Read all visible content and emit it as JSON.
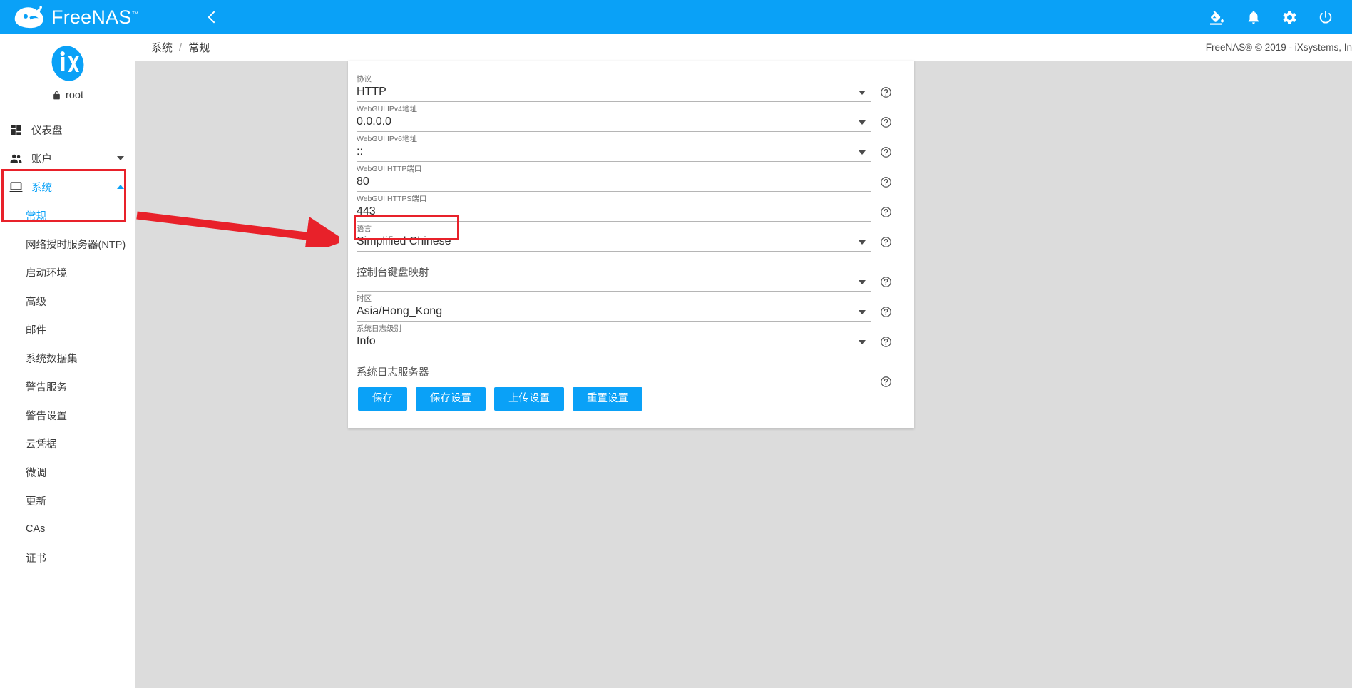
{
  "theme": {
    "accent": "#0aa1f7",
    "annotation": "#e8212a",
    "content_bg": "#dcdcdc"
  },
  "topbar": {
    "brand_name": "FreeNAS",
    "brand_tm": "™",
    "icons": [
      {
        "name": "menu-icon",
        "label": "☰"
      },
      {
        "name": "collapse-icon",
        "label": "‹"
      },
      {
        "name": "theme-picker-icon",
        "label": "theme"
      },
      {
        "name": "notifications-icon",
        "label": "bell"
      },
      {
        "name": "settings-icon",
        "label": "gear"
      },
      {
        "name": "power-icon",
        "label": "power"
      }
    ]
  },
  "breadcrumb": {
    "items": [
      "系统",
      "常规"
    ],
    "separator": "/",
    "copyright": "FreeNAS® © 2019 - iXsystems, In"
  },
  "sidebar": {
    "user": "root",
    "user_icon": "lock-icon",
    "items": [
      {
        "label": "仪表盘",
        "icon": "dashboard-icon",
        "expandable": false,
        "active": false
      },
      {
        "label": "账户",
        "icon": "people-icon",
        "expandable": true,
        "expanded": false,
        "active": false
      },
      {
        "label": "系统",
        "icon": "desktop-icon",
        "expandable": true,
        "expanded": true,
        "active": true
      }
    ],
    "system_children": [
      {
        "label": "常规",
        "active": true
      },
      {
        "label": "网络授时服务器(NTP)",
        "active": false
      },
      {
        "label": "启动环境",
        "active": false
      },
      {
        "label": "高级",
        "active": false
      },
      {
        "label": "邮件",
        "active": false
      },
      {
        "label": "系统数据集",
        "active": false
      },
      {
        "label": "警告服务",
        "active": false
      },
      {
        "label": "警告设置",
        "active": false
      },
      {
        "label": "云凭据",
        "active": false
      },
      {
        "label": "微调",
        "active": false
      },
      {
        "label": "更新",
        "active": false
      },
      {
        "label": "CAs",
        "active": false
      },
      {
        "label": "证书",
        "active": false
      }
    ]
  },
  "form": {
    "fields": [
      {
        "label": "协议",
        "value": "HTTP",
        "type": "select",
        "has_value": true
      },
      {
        "label": "WebGUI IPv4地址",
        "value": "0.0.0.0",
        "type": "select",
        "has_value": true
      },
      {
        "label": "WebGUI IPv6地址",
        "value": "::",
        "type": "select",
        "has_value": true
      },
      {
        "label": "WebGUI HTTP端口",
        "value": "80",
        "type": "text",
        "has_value": true
      },
      {
        "label": "WebGUI HTTPS端口",
        "value": "443",
        "type": "text",
        "has_value": true
      },
      {
        "label": "语言",
        "value": "Simplified Chinese",
        "type": "select",
        "has_value": true,
        "highlighted": true
      },
      {
        "label": "控制台键盘映射",
        "value": "",
        "type": "select",
        "has_value": false
      },
      {
        "label": "时区",
        "value": "Asia/Hong_Kong",
        "type": "select",
        "has_value": true
      },
      {
        "label": "系统日志级别",
        "value": "Info",
        "type": "select",
        "has_value": true
      },
      {
        "label": "系统日志服务器",
        "value": "",
        "type": "text",
        "has_value": false
      }
    ],
    "buttons": [
      {
        "label": "保存",
        "name": "save-button"
      },
      {
        "label": "保存设置",
        "name": "save-config-button"
      },
      {
        "label": "上传设置",
        "name": "upload-config-button"
      },
      {
        "label": "重置设置",
        "name": "reset-config-button"
      }
    ],
    "help_tooltip": "?"
  }
}
